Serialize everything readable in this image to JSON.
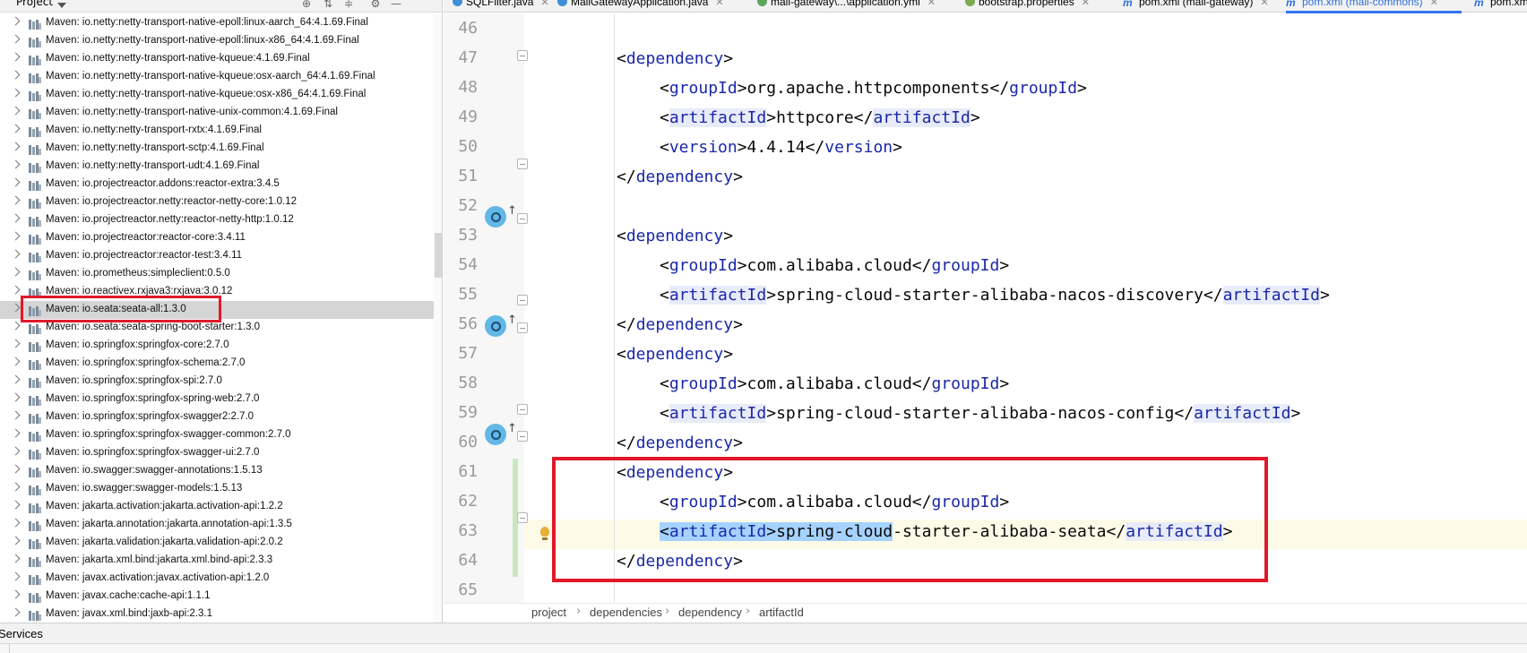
{
  "project_panel": {
    "title": "Project",
    "tree_items": [
      "Maven: io.netty:netty-transport-native-epoll:linux-aarch_64:4.1.69.Final",
      "Maven: io.netty:netty-transport-native-epoll:linux-x86_64:4.1.69.Final",
      "Maven: io.netty:netty-transport-native-kqueue:4.1.69.Final",
      "Maven: io.netty:netty-transport-native-kqueue:osx-aarch_64:4.1.69.Final",
      "Maven: io.netty:netty-transport-native-kqueue:osx-x86_64:4.1.69.Final",
      "Maven: io.netty:netty-transport-native-unix-common:4.1.69.Final",
      "Maven: io.netty:netty-transport-rxtx:4.1.69.Final",
      "Maven: io.netty:netty-transport-sctp:4.1.69.Final",
      "Maven: io.netty:netty-transport-udt:4.1.69.Final",
      "Maven: io.projectreactor.addons:reactor-extra:3.4.5",
      "Maven: io.projectreactor.netty:reactor-netty-core:1.0.12",
      "Maven: io.projectreactor.netty:reactor-netty-http:1.0.12",
      "Maven: io.projectreactor:reactor-core:3.4.11",
      "Maven: io.projectreactor:reactor-test:3.4.11",
      "Maven: io.prometheus:simpleclient:0.5.0",
      "Maven: io.reactivex.rxjava3:rxjava:3.0.12",
      "Maven: io.seata:seata-all:1.3.0",
      "Maven: io.seata:seata-spring-boot-starter:1.3.0",
      "Maven: io.springfox:springfox-core:2.7.0",
      "Maven: io.springfox:springfox-schema:2.7.0",
      "Maven: io.springfox:springfox-spi:2.7.0",
      "Maven: io.springfox:springfox-spring-web:2.7.0",
      "Maven: io.springfox:springfox-swagger2:2.7.0",
      "Maven: io.springfox:springfox-swagger-common:2.7.0",
      "Maven: io.springfox:springfox-swagger-ui:2.7.0",
      "Maven: io.swagger:swagger-annotations:1.5.13",
      "Maven: io.swagger:swagger-models:1.5.13",
      "Maven: jakarta.activation:jakarta.activation-api:1.2.2",
      "Maven: jakarta.annotation:jakarta.annotation-api:1.3.5",
      "Maven: jakarta.validation:jakarta.validation-api:2.0.2",
      "Maven: jakarta.xml.bind:jakarta.xml.bind-api:2.3.3",
      "Maven: javax.activation:javax.activation-api:1.2.0",
      "Maven: javax.cache:cache-api:1.1.1",
      "Maven: javax.xml.bind:jaxb-api:2.3.1"
    ],
    "selected_item": "Maven: io.seata:seata-all:1.3.0",
    "icons": [
      "globe-icon",
      "collapse-all-icon",
      "expand-all-icon",
      "settings-gear-icon",
      "minimize-icon"
    ]
  },
  "tabs": [
    {
      "label": "SQLFilter.java",
      "icon": "java-class-icon"
    },
    {
      "label": "MallGatewayApplication.java",
      "icon": "java-class-icon"
    },
    {
      "label": "mall-gateway\\...\\application.yml",
      "icon": "spring-yml-icon"
    },
    {
      "label": "bootstrap.properties",
      "icon": "spring-properties-icon"
    },
    {
      "label": "pom.xml (mall-gateway)",
      "icon": "maven-icon"
    },
    {
      "label": "pom.xml (mall-commons)",
      "icon": "maven-icon",
      "active": true
    },
    {
      "label": "pom.xm",
      "icon": "maven-icon"
    }
  ],
  "editor": {
    "line_numbers": [
      "46",
      "47",
      "48",
      "49",
      "50",
      "51",
      "52",
      "53",
      "54",
      "55",
      "56",
      "57",
      "58",
      "59",
      "60",
      "61",
      "62",
      "63",
      "64",
      "65"
    ],
    "lines": {
      "l47": {
        "open": "<",
        "tag": "dependency",
        "close": ">"
      },
      "l48": {
        "o1": "<",
        "tag": "groupId",
        "o2": ">",
        "text": "org.apache.httpcomponents",
        "o3": "</",
        "tag2": "groupId",
        "o4": ">"
      },
      "l49": {
        "o1": "<",
        "tag": "artifactId",
        "o2": ">",
        "text": "httpcore",
        "o3": "</",
        "tag2": "artifactId",
        "o4": ">"
      },
      "l50": {
        "o1": "<",
        "tag": "version",
        "o2": ">",
        "text": "4.4.14",
        "o3": "</",
        "tag2": "version",
        "o4": ">"
      },
      "l51": {
        "open": "</",
        "tag": "dependency",
        "close": ">"
      },
      "l53": {
        "open": "<",
        "tag": "dependency",
        "close": ">"
      },
      "l54": {
        "o1": "<",
        "tag": "groupId",
        "o2": ">",
        "text": "com.alibaba.cloud",
        "o3": "</",
        "tag2": "groupId",
        "o4": ">"
      },
      "l55": {
        "o1": "<",
        "tag": "artifactId",
        "o2": ">",
        "text": "spring-cloud-starter-alibaba-nacos-discovery",
        "o3": "</",
        "tag2": "artifactId",
        "o4": ">"
      },
      "l56": {
        "open": "</",
        "tag": "dependency",
        "close": ">"
      },
      "l57": {
        "open": "<",
        "tag": "dependency",
        "close": ">"
      },
      "l58": {
        "o1": "<",
        "tag": "groupId",
        "o2": ">",
        "text": "com.alibaba.cloud",
        "o3": "</",
        "tag2": "groupId",
        "o4": ">"
      },
      "l59": {
        "o1": "<",
        "tag": "artifactId",
        "o2": ">",
        "text": "spring-cloud-starter-alibaba-nacos-config",
        "o3": "</",
        "tag2": "artifactId",
        "o4": ">"
      },
      "l60": {
        "open": "</",
        "tag": "dependency",
        "close": ">"
      },
      "l61": {
        "open": "<",
        "tag": "dependency",
        "close": ">"
      },
      "l62": {
        "o1": "<",
        "tag": "groupId",
        "o2": ">",
        "text": "com.alibaba.cloud",
        "o3": "</",
        "tag2": "groupId",
        "o4": ">"
      },
      "l63": {
        "o1": "<",
        "tag": "artifactId",
        "o2": ">",
        "text_selected": "spring-cloud",
        "text_rest": "-starter-alibaba-seata",
        "o3": "</",
        "tag2": "artifactId",
        "o4": ">"
      },
      "l64": {
        "open": "</",
        "tag": "dependency",
        "close": ">"
      }
    }
  },
  "breadcrumb": [
    "project",
    "dependencies",
    "dependency",
    "artifactId"
  ],
  "bottom_bar": {
    "label": "Services"
  },
  "colors": {
    "highlight_box": "#e0192a",
    "xml_tag": "#1a28a8",
    "selection": "#a6d2ff",
    "active_tab": "#2f6fdb"
  }
}
